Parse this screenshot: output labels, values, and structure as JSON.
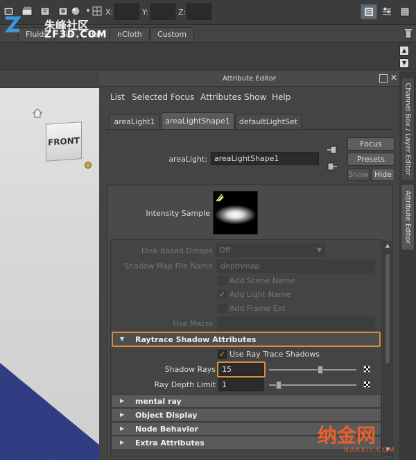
{
  "toolbar": {
    "coords": [
      {
        "label": "X:"
      },
      {
        "label": "Y:"
      },
      {
        "label": "Z:"
      }
    ],
    "icons": [
      "render-icon",
      "clapper-icon",
      "ipr-icon",
      "render-settings-icon",
      "hypershade-icon",
      "snap-icon"
    ]
  },
  "shelf": {
    "tabs": [
      "Fluids",
      "Fur",
      "Hair",
      "nCloth",
      "Custom"
    ]
  },
  "watermark_top": {
    "brand": "朱峰社区",
    "url": "ZF3D.COM"
  },
  "viewport": {
    "view_cube_label": "FRONT"
  },
  "attribute_editor": {
    "title": "Attribute Editor",
    "menu": [
      "List",
      "Selected",
      "Focus",
      "Attributes",
      "Show",
      "Help"
    ],
    "tabs": [
      "areaLight1",
      "areaLightShape1",
      "defaultLightSet"
    ],
    "node_type_label": "areaLight:",
    "node_name": "areaLightShape1",
    "buttons": {
      "focus": "Focus",
      "presets": "Presets",
      "show": "Show",
      "hide": "Hide"
    },
    "intensity_sample_label": "Intensity Sample",
    "disk_based_dmaps": {
      "label": "Disk Based Dmaps",
      "value": "Off"
    },
    "shadow_map_file_name": {
      "label": "Shadow Map File Name",
      "value": "depthmap"
    },
    "add_scene_name": {
      "label": "Add Scene Name",
      "checked": false
    },
    "add_light_name": {
      "label": "Add Light Name",
      "checked": true
    },
    "add_frame_ext": {
      "label": "Add Frame Ext",
      "checked": false
    },
    "use_macro": {
      "label": "Use Macro",
      "value": ""
    },
    "raytrace_section": "Raytrace Shadow Attributes",
    "use_ray_trace_shadows": {
      "label": "Use Ray Trace Shadows",
      "checked": true
    },
    "shadow_rays": {
      "label": "Shadow Rays",
      "value": "15",
      "slider_fraction": 0.59
    },
    "ray_depth_limit": {
      "label": "Ray Depth Limit",
      "value": "1",
      "slider_fraction": 0.11
    },
    "collapsed_sections": [
      "mental ray",
      "Object Display",
      "Node Behavior",
      "Extra Attributes"
    ]
  },
  "side_tabs": {
    "channel_box": "Channel Box / Layer Editor",
    "attribute_editor": "Attribute Editor"
  },
  "watermark_bottom": {
    "brand": "纳金网",
    "url": "NARKII.COM"
  },
  "colors": {
    "highlight": "#d98c3a",
    "check": "#f0a030",
    "panel": "#444444"
  }
}
